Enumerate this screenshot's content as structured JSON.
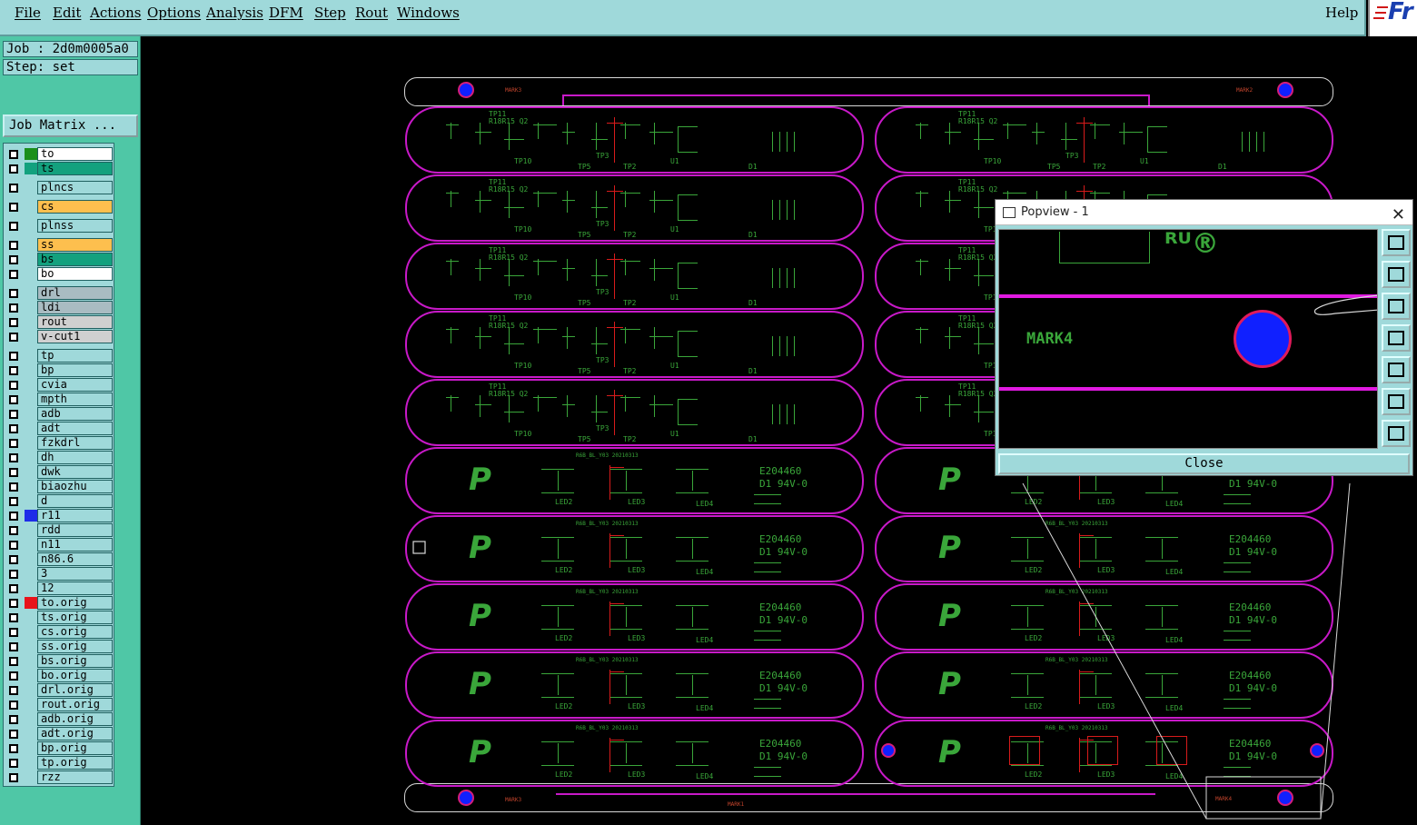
{
  "menu": {
    "file": "File",
    "edit": "Edit",
    "actions": "Actions",
    "options": "Options",
    "analysis": "Analysis",
    "dfm": "DFM",
    "step": "Step",
    "rout": "Rout",
    "windows": "Windows",
    "help": "Help"
  },
  "logo_text": "Fr",
  "job_label": "Job : 2d0m0005a0",
  "step_label": "Step: set",
  "job_matrix": "Job Matrix ...",
  "layers": [
    {
      "name": "to",
      "color": "#ffffff",
      "swatch": "#1b8f1b"
    },
    {
      "name": "ts",
      "color": "#13a17e",
      "swatch": "#13a17e"
    },
    {
      "name": "plncs",
      "color": "#9fd9da",
      "swatch": ""
    },
    {
      "name": "cs",
      "color": "#fdbf4e",
      "swatch": ""
    },
    {
      "name": "plnss",
      "color": "#9fd9da",
      "swatch": ""
    },
    {
      "name": "ss",
      "color": "#fdbf4e",
      "swatch": ""
    },
    {
      "name": "bs",
      "color": "#13a17e",
      "swatch": ""
    },
    {
      "name": "bo",
      "color": "#ffffff",
      "swatch": ""
    },
    {
      "name": "drl",
      "color": "#a9bcc2",
      "swatch": ""
    },
    {
      "name": "ldi",
      "color": "#a9bcc2",
      "swatch": ""
    },
    {
      "name": "rout",
      "color": "#d0d0d0",
      "swatch": ""
    },
    {
      "name": "v-cut1",
      "color": "#d0d0d0",
      "swatch": ""
    },
    {
      "name": "tp",
      "color": "#9fd9da",
      "swatch": ""
    },
    {
      "name": "bp",
      "color": "#9fd9da",
      "swatch": ""
    },
    {
      "name": "cvia",
      "color": "#9fd9da",
      "swatch": ""
    },
    {
      "name": "mpth",
      "color": "#9fd9da",
      "swatch": ""
    },
    {
      "name": "adb",
      "color": "#9fd9da",
      "swatch": ""
    },
    {
      "name": "adt",
      "color": "#9fd9da",
      "swatch": ""
    },
    {
      "name": "fzkdrl",
      "color": "#9fd9da",
      "swatch": ""
    },
    {
      "name": "dh",
      "color": "#9fd9da",
      "swatch": ""
    },
    {
      "name": "dwk",
      "color": "#9fd9da",
      "swatch": ""
    },
    {
      "name": "biaozhu",
      "color": "#9fd9da",
      "swatch": ""
    },
    {
      "name": "d",
      "color": "#9fd9da",
      "swatch": ""
    },
    {
      "name": "r11",
      "color": "#9fd9da",
      "swatch": "#1e2ce8"
    },
    {
      "name": "rdd",
      "color": "#9fd9da",
      "swatch": ""
    },
    {
      "name": "n11",
      "color": "#9fd9da",
      "swatch": ""
    },
    {
      "name": "n86.6",
      "color": "#9fd9da",
      "swatch": ""
    },
    {
      "name": "3",
      "color": "#9fd9da",
      "swatch": ""
    },
    {
      "name": "12",
      "color": "#9fd9da",
      "swatch": ""
    },
    {
      "name": "to.orig",
      "color": "#9fd9da",
      "swatch": "#e8141b"
    },
    {
      "name": "ts.orig",
      "color": "#9fd9da",
      "swatch": ""
    },
    {
      "name": "cs.orig",
      "color": "#9fd9da",
      "swatch": ""
    },
    {
      "name": "ss.orig",
      "color": "#9fd9da",
      "swatch": ""
    },
    {
      "name": "bs.orig",
      "color": "#9fd9da",
      "swatch": ""
    },
    {
      "name": "bo.orig",
      "color": "#9fd9da",
      "swatch": ""
    },
    {
      "name": "drl.orig",
      "color": "#9fd9da",
      "swatch": ""
    },
    {
      "name": "rout.orig",
      "color": "#9fd9da",
      "swatch": ""
    },
    {
      "name": "adb.orig",
      "color": "#9fd9da",
      "swatch": ""
    },
    {
      "name": "adt.orig",
      "color": "#9fd9da",
      "swatch": ""
    },
    {
      "name": "bp.orig",
      "color": "#9fd9da",
      "swatch": ""
    },
    {
      "name": "tp.orig",
      "color": "#9fd9da",
      "swatch": ""
    },
    {
      "name": "rzz",
      "color": "#9fd9da",
      "swatch": ""
    }
  ],
  "popview": {
    "title": "Popview - 1",
    "close_x": "✕",
    "mark_text": "MARK4",
    "ul_text": "ᴿᵁ®",
    "close_button": "Close"
  },
  "silk": {
    "e_code": "E204460",
    "rating": "D1 94V-0",
    "led2": "LED2",
    "led3": "LED3",
    "led4": "LED4",
    "tp11": "TP11",
    "r1815": "R18R15 Q2",
    "tp10": "TP10",
    "tp5": "TP5",
    "tp2": "TP2",
    "tp3": "TP3",
    "d1": "D1",
    "u1": "U1",
    "header_code": "R6B_BL_Y03 20210313"
  },
  "marks": {
    "top_left": "MARK3",
    "top_right": "MARK2",
    "bottom_left": "MARK3",
    "bottom_mid": "MARK1",
    "bottom_right": "MARK4"
  }
}
